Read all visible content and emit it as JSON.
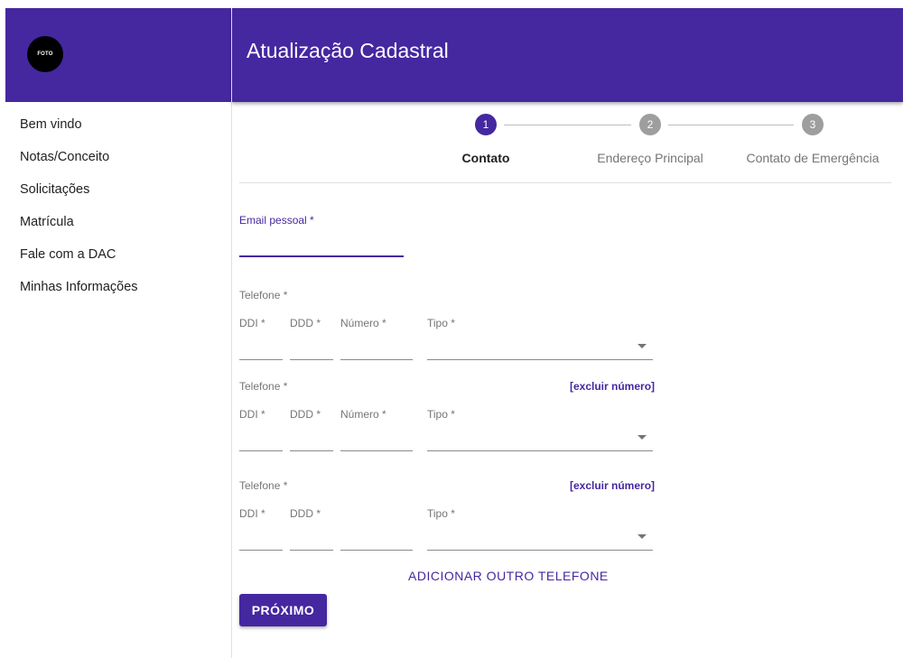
{
  "sidebar": {
    "avatar_text": "FOTO",
    "items": [
      {
        "label": "Bem vindo"
      },
      {
        "label": "Notas/Conceito"
      },
      {
        "label": "Solicitações"
      },
      {
        "label": "Matrícula"
      },
      {
        "label": "Fale com a DAC"
      },
      {
        "label": "Minhas Informações"
      }
    ]
  },
  "header": {
    "title": "Atualização Cadastral"
  },
  "stepper": {
    "current": 1,
    "steps": [
      {
        "number": "1",
        "label": "Contato"
      },
      {
        "number": "2",
        "label": "Endereço Principal"
      },
      {
        "number": "3",
        "label": "Contato de Emergência"
      }
    ]
  },
  "form": {
    "email": {
      "label": "Email pessoal *",
      "value": ""
    },
    "phones": [
      {
        "label": "Telefone *",
        "ddi_label": "DDI *",
        "ddd_label": "DDD *",
        "numero_label": "Número *",
        "tipo_label": "Tipo *",
        "ddi": "",
        "ddd": "",
        "numero": "",
        "tipo": ""
      },
      {
        "label": "Telefone *",
        "delete_label": "[excluir número]",
        "ddi_label": "DDI *",
        "ddd_label": "DDD *",
        "numero_label": "Número *",
        "tipo_label": "Tipo *",
        "ddi": "",
        "ddd": "",
        "numero": "",
        "tipo": ""
      },
      {
        "label": "Telefone *",
        "delete_label": "[excluir número]",
        "ddi_label": "DDI *",
        "ddd_label": "DDD *",
        "tipo_label": "Tipo *",
        "ddi": "",
        "ddd": "",
        "numero": "",
        "tipo": ""
      }
    ],
    "add_phone_label": "ADICIONAR OUTRO TELEFONE",
    "next_label": "PRÓXIMO"
  },
  "colors": {
    "primary": "#4527a0",
    "inactive_step": "#9e9e9e",
    "text": "#212121",
    "muted": "#757575"
  }
}
